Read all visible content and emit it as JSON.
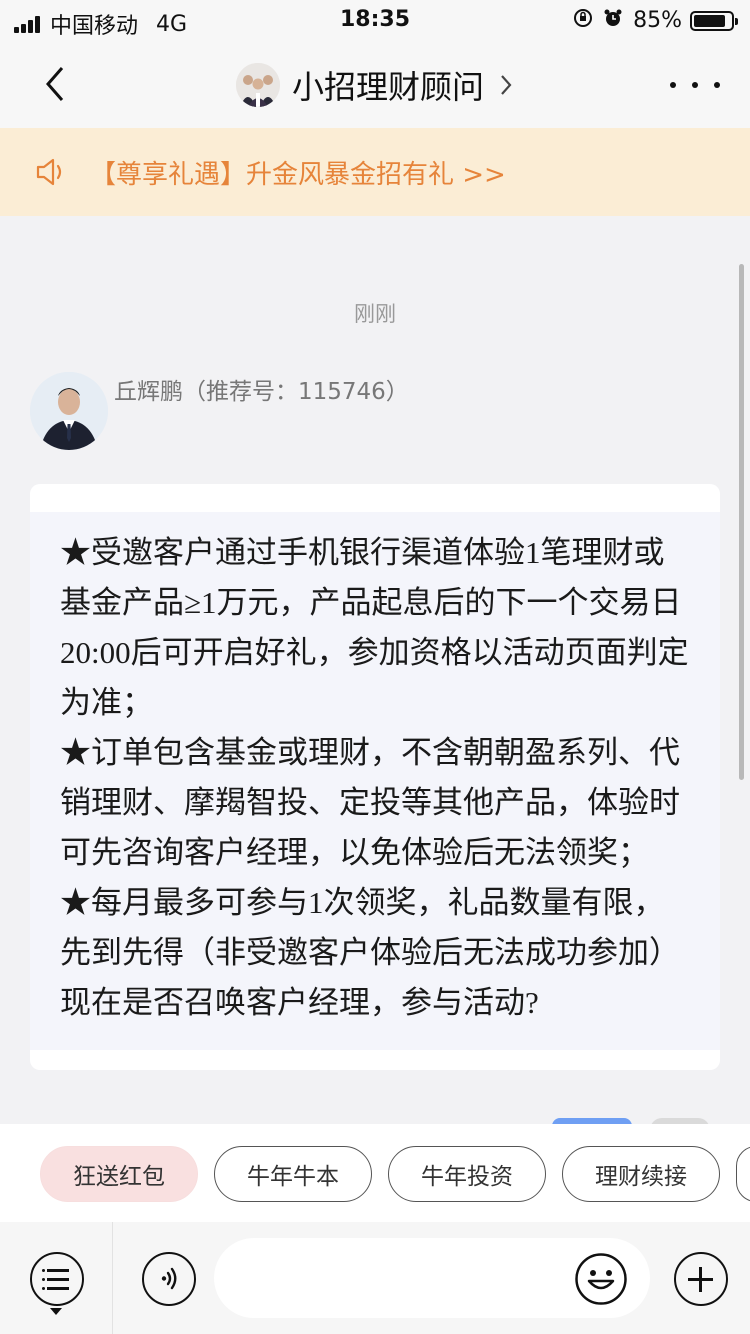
{
  "status_bar": {
    "carrier": "中国移动",
    "network": "4G",
    "time": "18:35",
    "battery_percent": "85%",
    "battery_level": 0.85
  },
  "nav": {
    "title": "小招理财顾问",
    "back_icon": "chevron-left-icon",
    "title_chevron_icon": "chevron-right-icon",
    "more_icon": "more-dots-icon"
  },
  "notice": {
    "icon": "speaker-icon",
    "text": "【尊享礼遇】升金风暴金招有礼 >>",
    "color": "#e6843a",
    "background": "#fbedd5"
  },
  "chat": {
    "timestamp": "刚刚",
    "sender_name": "丘辉鹏（推荐号：115746）",
    "message": "★受邀客户通过手机银行渠道体验1笔理财或\n基金产品≥1万元，产品起息后的下一个交易日\n20:00后可开启好礼，参加资格以活动页面判定\n为准；\n★订单包含基金或理财，不含朝朝盈系列、代\n销理财、摩羯智投、定投等其他产品，体验时\n可先咨询客户经理，以免体验后无法领奖；\n★每月最多可参与1次领奖，礼品数量有限，\n先到先得（非受邀客户体验后无法成功参加）\n现在是否召唤客户经理，参与活动?"
  },
  "quick_replies": [
    {
      "label": "狂送红包",
      "active": true
    },
    {
      "label": "牛年牛本",
      "active": false
    },
    {
      "label": "牛年投资",
      "active": false
    },
    {
      "label": "理财续接",
      "active": false
    },
    {
      "label": "",
      "active": false
    }
  ],
  "input_bar": {
    "placeholder": "",
    "menu_icon": "menu-list-icon",
    "voice_icon": "voice-icon",
    "emoji_icon": "emoji-icon",
    "plus_icon": "plus-icon"
  }
}
